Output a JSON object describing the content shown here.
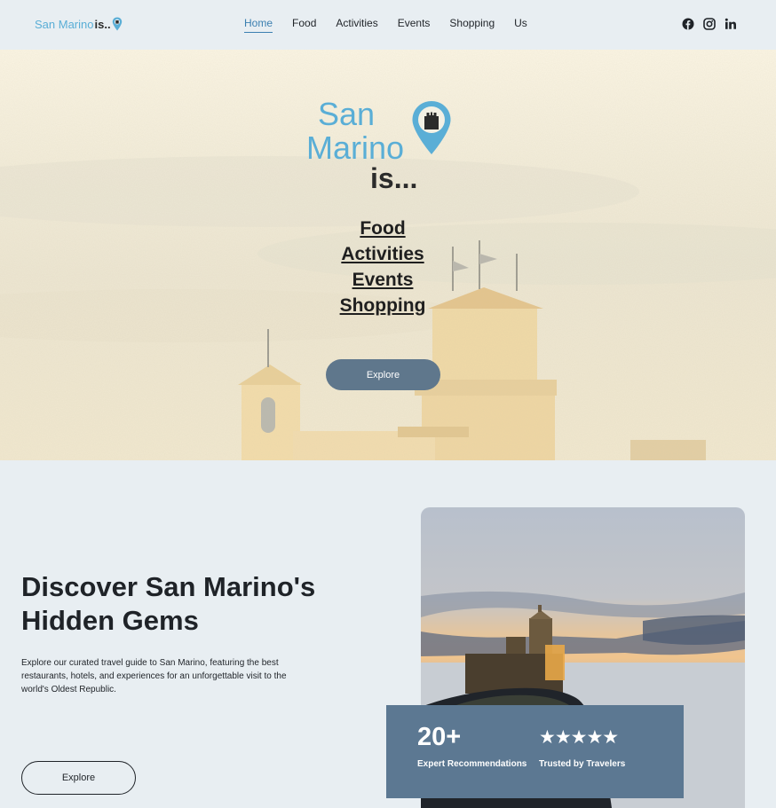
{
  "header": {
    "logo_word1": "San Marino",
    "logo_word2": "is..",
    "nav": [
      {
        "label": "Home",
        "active": true
      },
      {
        "label": "Food"
      },
      {
        "label": "Activities"
      },
      {
        "label": "Events"
      },
      {
        "label": "Shopping"
      },
      {
        "label": "Us"
      }
    ],
    "socials": [
      "facebook-icon",
      "instagram-icon",
      "linkedin-icon"
    ]
  },
  "hero": {
    "logo_san": "San",
    "logo_marino": "Marino",
    "logo_is": "is...",
    "links": [
      "Food",
      "Activities",
      "Events",
      "Shopping"
    ],
    "button_label": "Explore"
  },
  "about": {
    "heading": "Discover San Marino's Hidden Gems",
    "description": "Explore our curated travel guide to San Marino, featuring the best restaurants, hotels, and experiences for an unforgettable visit to the world's Oldest Republic.",
    "button_label": "Explore"
  },
  "stats": {
    "count": "20+",
    "count_label": "Expert Recommendations",
    "stars": "★★★★★",
    "stars_label": "Trusted by Travelers"
  },
  "colors": {
    "brand_blue": "#5aaed6",
    "button_slate": "#5f778c",
    "stats_bg": "#5c7892",
    "page_bg": "#e8eef2"
  }
}
